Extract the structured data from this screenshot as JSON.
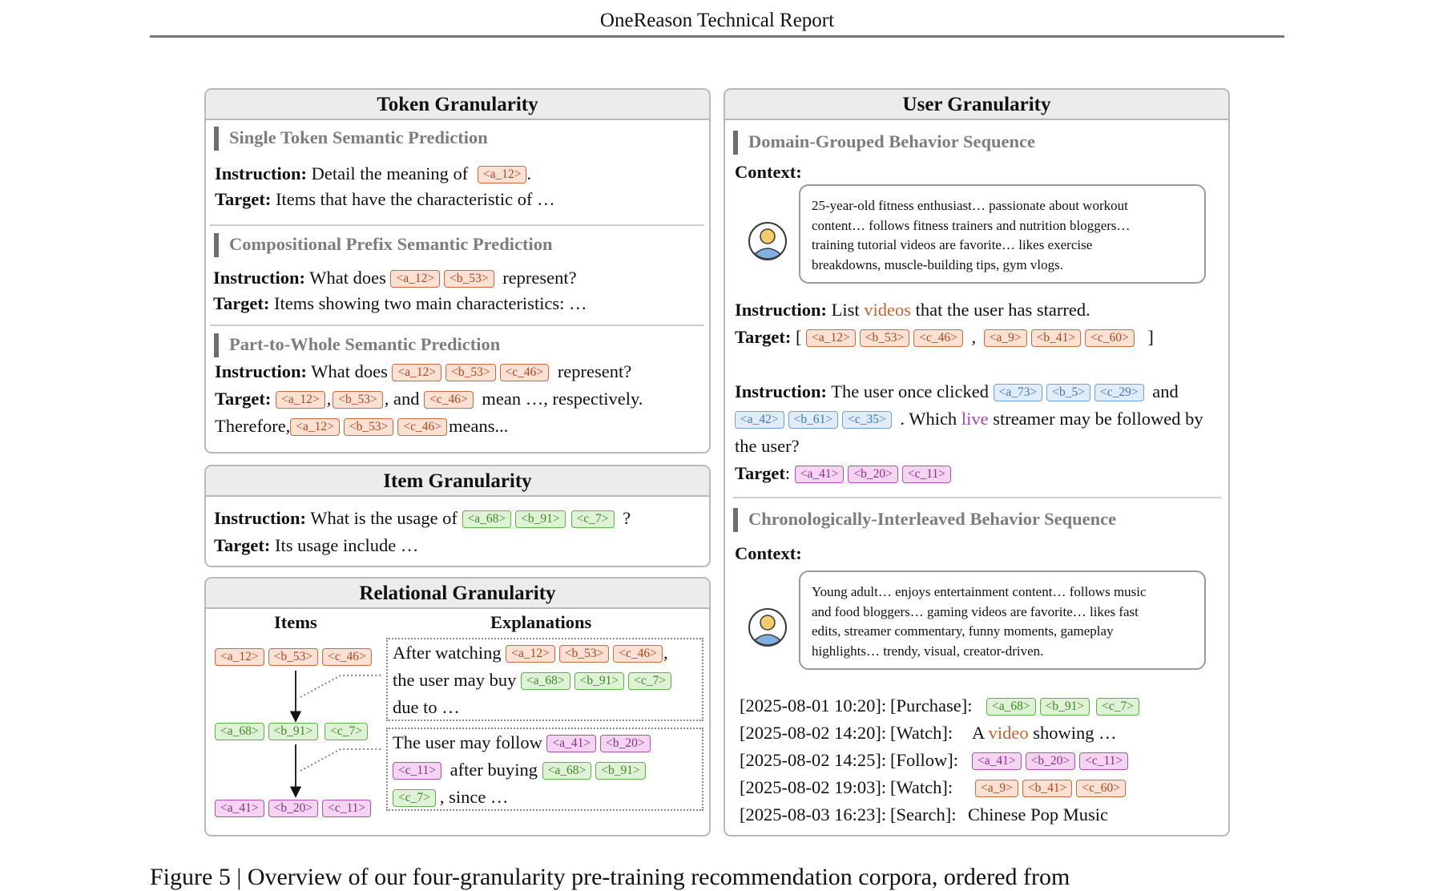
{
  "header": {
    "title": "OneReason Technical Report"
  },
  "token_granularity": {
    "title": "Token Granularity",
    "single": {
      "heading": "Single Token Semantic Prediction",
      "instruction_label": "Instruction:",
      "instruction_text": "Detail the meaning of",
      "tokens": [
        "<a_12>"
      ],
      "period": ".",
      "target_label": "Target:",
      "target_text": "Items that have the characteristic of …"
    },
    "compositional": {
      "heading": "Compositional Prefix Semantic Prediction",
      "instruction_label": "Instruction:",
      "instruction_text": "What does",
      "tokens": [
        "<a_12>",
        "<b_53>"
      ],
      "instruction_end": "represent?",
      "target_label": "Target:",
      "target_text": "Items showing two main characteristics: …"
    },
    "part_whole": {
      "heading": "Part-to-Whole Semantic Prediction",
      "instruction_label": "Instruction:",
      "instruction_text": "What does",
      "tokens": [
        "<a_12>",
        "<b_53>",
        "<c_46>"
      ],
      "instruction_end": "represent?",
      "target_label": "Target:",
      "comma1": ",",
      "comma2": ", and",
      "target_end": "mean …, respectively.",
      "therefore": "Therefore,",
      "means": "means..."
    }
  },
  "item_granularity": {
    "title": "Item Granularity",
    "instruction_label": "Instruction:",
    "instruction_text": "What is the usage of",
    "tokens": [
      "<a_68>",
      "<b_91>",
      "<c_7>"
    ],
    "qmark": "?",
    "target_label": "Target:",
    "target_text": "Its usage include …"
  },
  "relational_granularity": {
    "title": "Relational Granularity",
    "items_header": "Items",
    "explanations_header": "Explanations",
    "orange_tokens": [
      "<a_12>",
      "<b_53>",
      "<c_46>"
    ],
    "green_tokens": [
      "<a_68>",
      "<b_91>",
      "<c_7>"
    ],
    "purple_tokens": [
      "<a_41>",
      "<b_20>",
      "<c_11>"
    ],
    "expl1": {
      "p1": "After watching",
      "p1_end": ",",
      "p2": "the user may buy",
      "p3": "due to …"
    },
    "expl2": {
      "p1": "The user may follow",
      "p2": "after buying",
      "p3": ", since …"
    }
  },
  "user_granularity": {
    "title": "User Granularity",
    "domain": {
      "heading": "Domain-Grouped Behavior Sequence",
      "context_label": "Context:",
      "context_lines": [
        "25-year-old fitness enthusiast… passionate about workout",
        "content… follows fitness trainers and nutrition bloggers…",
        "training tutorial videos are favorite… likes exercise",
        "breakdowns, muscle-building tips, gym vlogs."
      ],
      "q1": {
        "instruction_label": "Instruction:",
        "pre": "List",
        "highlight": "videos",
        "post": "that the user has starred.",
        "target_label": "Target:",
        "open": "[",
        "comma": ",",
        "close": "]",
        "group1": [
          "<a_12>",
          "<b_53>",
          "<c_46>"
        ],
        "group2": [
          "<a_9>",
          "<b_41>",
          "<c_60>"
        ]
      },
      "q2": {
        "instruction_label": "Instruction:",
        "pre": "The user once clicked",
        "blue1": [
          "<a_73>",
          "<b_5>",
          "<c_29>"
        ],
        "and": "and",
        "blue2": [
          "<a_42>",
          "<b_61>",
          "<c_35>"
        ],
        "mid": ". Which",
        "highlight": "live",
        "post": "streamer may be followed by",
        "line3": "the user?",
        "target_label": "Target",
        "target_colon": ":",
        "target_tokens": [
          "<a_41>",
          "<b_20>",
          "<c_11>"
        ]
      }
    },
    "chrono": {
      "heading": "Chronologically-Interleaved Behavior Sequence",
      "context_label": "Context:",
      "context_lines": [
        "Young adult… enjoys entertainment content… follows music",
        "and food bloggers… gaming videos are favorite… likes fast",
        "edits, streamer commentary, funny moments, gameplay",
        "highlights… trendy, visual, creator-driven."
      ],
      "events": [
        {
          "time": "[2025-08-01 10:20]:",
          "action": "[Purchase]:",
          "tokens": [
            "<a_68>",
            "<b_91>",
            "<c_7>"
          ],
          "color": "g"
        },
        {
          "time": "[2025-08-02 14:20]:",
          "action": "[Watch]:",
          "pre": "A",
          "highlight": "video",
          "post": "showing …"
        },
        {
          "time": "[2025-08-02 14:25]:",
          "action": "[Follow]:",
          "tokens": [
            "<a_41>",
            "<b_20>",
            "<c_11>"
          ],
          "color": "p"
        },
        {
          "time": "[2025-08-02 19:03]:",
          "action": "[Watch]:",
          "tokens": [
            "<a_9>",
            "<b_41>",
            "<c_60>"
          ],
          "color": "o"
        },
        {
          "time": "[2025-08-03 16:23]:",
          "action": "[Search]:",
          "text": "Chinese Pop Music"
        }
      ]
    }
  },
  "caption": {
    "text": "Figure 5 | Overview of our four-granularity pre-training recommendation corpora, ordered from"
  },
  "colors": {
    "orange": "#d4683a",
    "green": "#5cb345",
    "blue": "#6fa1db",
    "purple": "#b24fb3"
  }
}
